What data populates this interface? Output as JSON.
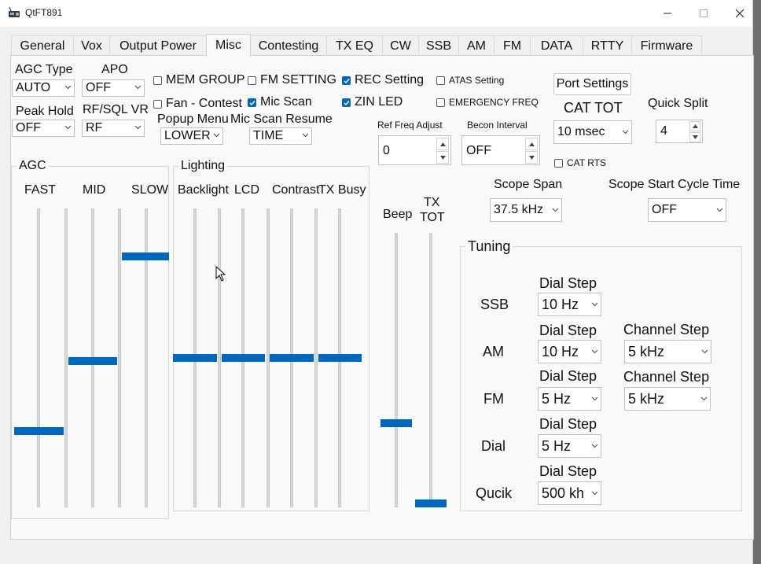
{
  "window": {
    "title": "QtFT891",
    "controls": {
      "minimize": "—",
      "maximize": "☐",
      "close": "✕"
    }
  },
  "tabs": [
    {
      "label": "General"
    },
    {
      "label": "Vox"
    },
    {
      "label": "Output Power"
    },
    {
      "label": "Misc"
    },
    {
      "label": "Contesting"
    },
    {
      "label": "TX EQ"
    },
    {
      "label": "CW"
    },
    {
      "label": "SSB"
    },
    {
      "label": "AM"
    },
    {
      "label": "FM"
    },
    {
      "label": "DATA"
    },
    {
      "label": "RTTY"
    },
    {
      "label": "Firmware"
    }
  ],
  "active_tab": "Misc",
  "top": {
    "agc_type": {
      "label": "AGC Type",
      "value": "AUTO"
    },
    "apo": {
      "label": "APO",
      "value": "OFF"
    },
    "peak_hold": {
      "label": "Peak Hold",
      "value": "OFF"
    },
    "rf_sql_vr": {
      "label": "RF/SQL VR",
      "value": "RF"
    },
    "popup_menu": {
      "label": "Popup Menu",
      "value": "LOWER"
    },
    "mic_scan_resume": {
      "label": "Mic Scan Resume",
      "value": "TIME"
    }
  },
  "checkboxes": {
    "mem_group": {
      "label": "MEM GROUP",
      "checked": false
    },
    "fm_setting": {
      "label": "FM SETTING",
      "checked": false
    },
    "rec_setting": {
      "label": "REC Setting",
      "checked": true
    },
    "atas_setting": {
      "label": "ATAS Setting",
      "checked": false
    },
    "fan_contest": {
      "label": "Fan - Contest",
      "checked": false
    },
    "mic_scan": {
      "label": "Mic Scan",
      "checked": true
    },
    "zin_led": {
      "label": "ZIN LED",
      "checked": true
    },
    "emergency_freq": {
      "label": "EMERGENCY FREQ",
      "checked": false
    },
    "cat_rts": {
      "label": "CAT RTS",
      "checked": false
    }
  },
  "ref_freq_adjust": {
    "label": "Ref Freq Adjust",
    "value": "0"
  },
  "becon_interval": {
    "label": "Becon Interval",
    "value": "OFF"
  },
  "port_settings": {
    "label": "Port Settings"
  },
  "cat_tot": {
    "label": "CAT TOT",
    "value": "10 msec"
  },
  "quick_split": {
    "label": "Quick Split",
    "value": "4"
  },
  "scope_span": {
    "label": "Scope Span",
    "value": "37.5 kHz"
  },
  "scope_start_cycle_time": {
    "label": "Scope Start Cycle Time",
    "value": "OFF"
  },
  "agc_group": {
    "title": "AGC",
    "sliders": [
      {
        "label": "FAST",
        "level": 0.25
      },
      {
        "label": "MID",
        "level": 0.49
      },
      {
        "label": "SLOW",
        "level": 0.85
      }
    ]
  },
  "lighting_group": {
    "title": "Lighting",
    "sliders": [
      {
        "label": "Backlight",
        "level": 0.5
      },
      {
        "label": "LCD",
        "level": 0.5
      },
      {
        "label": "Contrast",
        "level": 0.5
      },
      {
        "label": "TX Busy",
        "level": 0.5
      }
    ]
  },
  "beep": {
    "label": "Beep",
    "level": 0.3
  },
  "tx_tot": {
    "label_line1": "TX",
    "label_line2": "TOT",
    "level": 0.0
  },
  "tuning": {
    "title": "Tuning",
    "dial_step_label": "Dial Step",
    "channel_step_label": "Channel Step",
    "rows": [
      {
        "mode": "SSB",
        "dial_step": "10 Hz"
      },
      {
        "mode": "AM",
        "dial_step": "10 Hz",
        "channel_step": "5 kHz"
      },
      {
        "mode": "FM",
        "dial_step": "5 Hz",
        "channel_step": "5 kHz"
      },
      {
        "mode": "Dial",
        "dial_step": "5 Hz"
      },
      {
        "mode": "Qucik",
        "dial_step": "500 kh"
      }
    ]
  }
}
